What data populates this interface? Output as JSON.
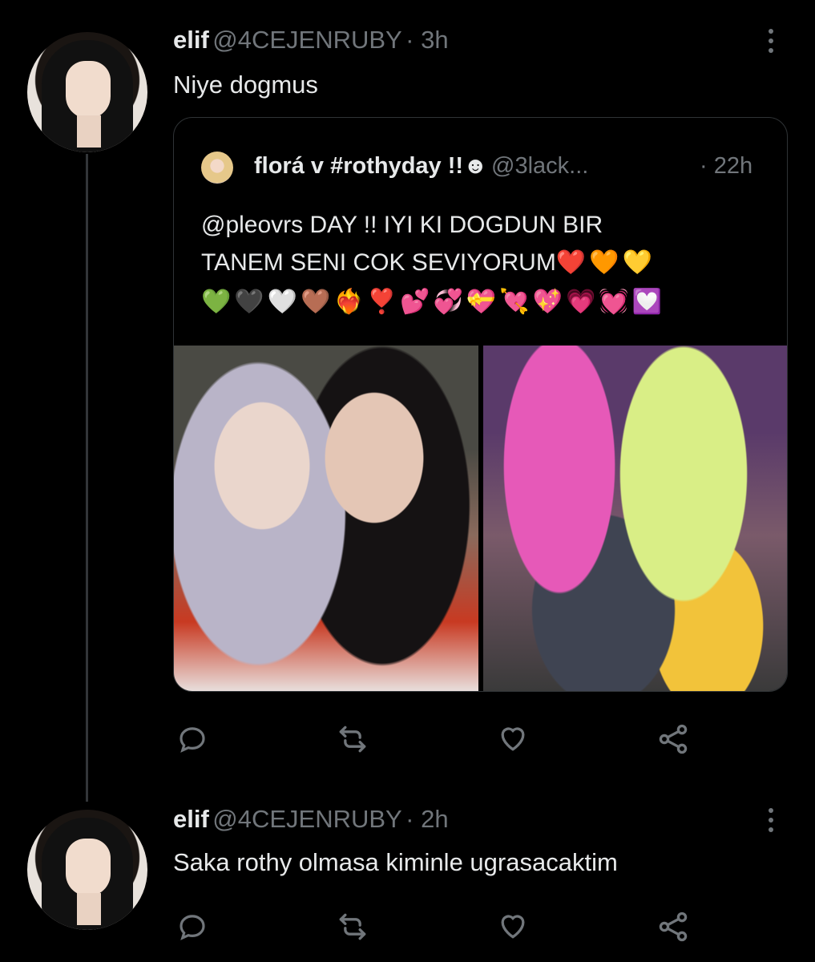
{
  "tweets": [
    {
      "author_name": "elif",
      "author_handle": "@4CEJENRUBY",
      "time": "· 3h",
      "text": "Niye dogmus",
      "quoted": {
        "author_name": "florá v #rothyday !!☻",
        "author_handle": "@3lack...",
        "time": "· 22h",
        "text_line1": "@pleovrs DAY !! IYI KI DOGDUN BIR",
        "text_line2": "TANEM SENI COK SEVIYORUM",
        "emojis_line2": [
          "❤️",
          "🧡",
          "💛"
        ],
        "emojis_line3": [
          "💚",
          "🖤",
          "🤍",
          "🤎",
          "❤️‍🔥",
          "❣️",
          "💕",
          "💞",
          "💝",
          "💘",
          "💖",
          "💗",
          "💓",
          "💟"
        ]
      }
    },
    {
      "author_name": "elif",
      "author_handle": "@4CEJENRUBY",
      "time": "· 2h",
      "text": "Saka rothy olmasa kiminle ugrasacaktim"
    }
  ],
  "icons": {
    "reply": "reply-icon",
    "retweet": "retweet-icon",
    "like": "like-icon",
    "share": "share-icon",
    "more": "more-icon"
  },
  "colors": {
    "background": "#000000",
    "text": "#e7e9ea",
    "secondary": "#71767b",
    "border": "#2f3336"
  }
}
